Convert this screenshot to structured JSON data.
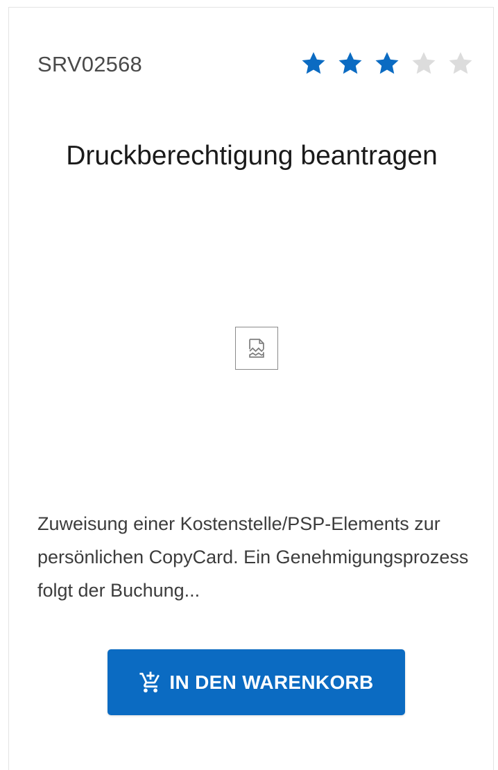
{
  "card": {
    "service_id": "SRV02568",
    "title": "Druckberechtigung beantragen",
    "description": "Zuweisung einer Kostenstelle/PSP-Elements zur persönlichen CopyCard. Ein Genehmigungsprozess folgt der Buchung...",
    "rating": {
      "value": 3,
      "max": 5,
      "filled_color": "#0b6bc2",
      "empty_color": "#dcdcdc"
    },
    "image": {
      "icon": "broken-image-icon"
    },
    "cart_button": {
      "label": "IN DEN WARENKORB",
      "icon": "add-to-cart-icon",
      "background": "#0b6bc2"
    }
  }
}
